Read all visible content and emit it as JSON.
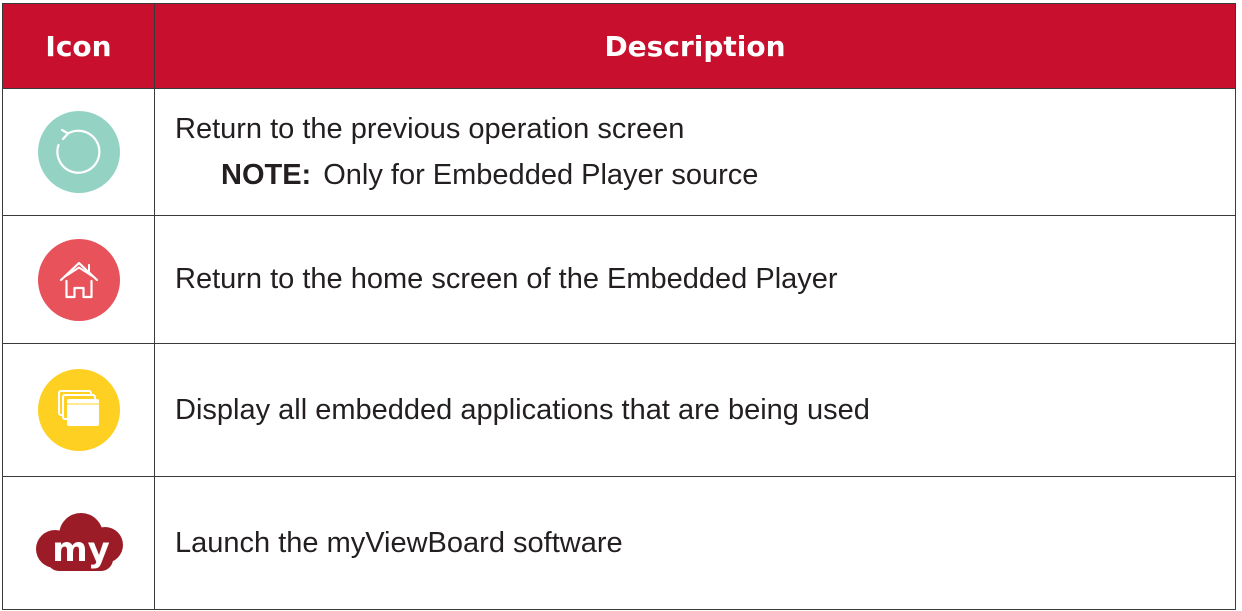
{
  "table": {
    "headers": {
      "icon": "Icon",
      "description": "Description"
    },
    "rows": [
      {
        "icon": "return-icon",
        "icon_color": "#94d3c3",
        "description": "Return to the previous operation screen",
        "note_label": "NOTE:",
        "note_text": "Only for Embedded Player source"
      },
      {
        "icon": "home-icon",
        "icon_color": "#e8525a",
        "description": "Return to the home screen of the Embedded Player"
      },
      {
        "icon": "windows-icon",
        "icon_color": "#fdd022",
        "description": "Display all embedded applications that are being used"
      },
      {
        "icon": "myviewboard-cloud-icon",
        "icon_color": "#9b1c26",
        "icon_text": "my",
        "description": "Launch the myViewBoard software"
      }
    ]
  },
  "colors": {
    "header_background": "#c8102e",
    "header_text": "#ffffff",
    "border": "#3a3a3a"
  }
}
